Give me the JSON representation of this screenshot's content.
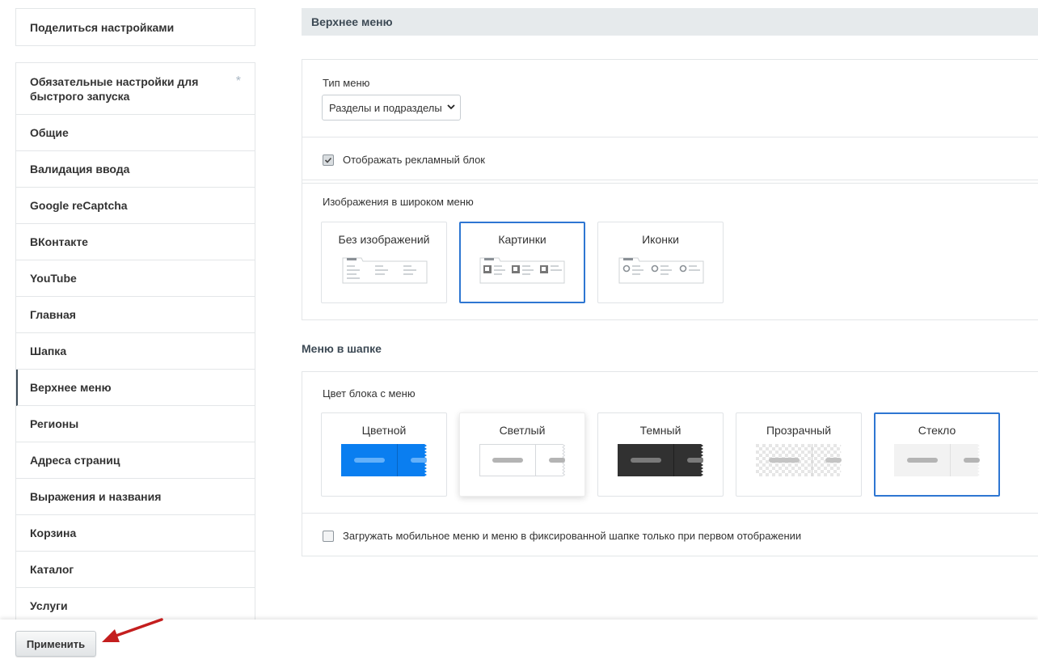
{
  "sidebar": {
    "share_label": "Поделиться настройками",
    "items": [
      {
        "label": "Обязательные настройки для быстрого запуска",
        "marker": "*"
      },
      {
        "label": "Общие"
      },
      {
        "label": "Валидация ввода"
      },
      {
        "label": "Google reCaptcha"
      },
      {
        "label": "ВКонтакте"
      },
      {
        "label": "YouTube"
      },
      {
        "label": "Главная"
      },
      {
        "label": "Шапка"
      },
      {
        "label": "Верхнее меню"
      },
      {
        "label": "Регионы"
      },
      {
        "label": "Адреса страниц"
      },
      {
        "label": "Выражения и названия"
      },
      {
        "label": "Корзина"
      },
      {
        "label": "Каталог"
      },
      {
        "label": "Услуги"
      }
    ],
    "active_item": "Верхнее меню"
  },
  "main": {
    "header_title": "Верхнее меню",
    "menu_type": {
      "label": "Тип меню",
      "selected": "Разделы и подразделы"
    },
    "ad_block": {
      "label": "Отображать рекламный блок",
      "checked": true
    },
    "wide_menu_images": {
      "label": "Изображения в широком меню",
      "options": [
        "Без изображений",
        "Картинки",
        "Иконки"
      ],
      "selected": "Картинки"
    },
    "header_menu_section": {
      "title": "Меню в шапке",
      "color_label": "Цвет блока с меню",
      "options": [
        {
          "label": "Цветной",
          "color": "#0a7ef0",
          "line": "#63b0fa"
        },
        {
          "label": "Светлый",
          "color": "#ffffff",
          "line": "#b4b4b4"
        },
        {
          "label": "Темный",
          "color": "#313131",
          "line": "#7a7a7a"
        },
        {
          "label": "Прозрачный",
          "color": "transparent",
          "line": "#c4c4c4"
        },
        {
          "label": "Стекло",
          "color": "#f2f2f2",
          "line": "#b4b4b4"
        }
      ],
      "selected": "Стекло"
    },
    "lazy_load": {
      "label": "Загружать мобильное меню и меню в фиксированной шапке только при первом отображении",
      "checked": false
    }
  },
  "footer": {
    "apply_label": "Применить"
  },
  "colors": {
    "accent": "#2e76d2",
    "arrow": "#c41e1e",
    "header_bg": "#e6eaec"
  }
}
